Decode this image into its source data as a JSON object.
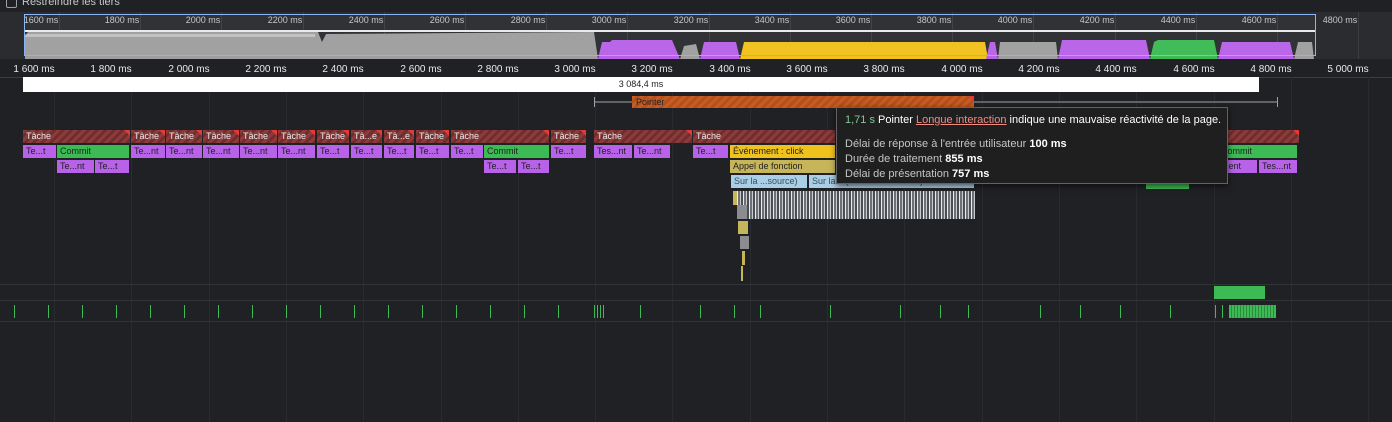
{
  "toolbar": {
    "checkbox_label": "Restreindre les tiers"
  },
  "overview": {
    "ticks": [
      "1600 ms",
      "1800 ms",
      "2000 ms",
      "2200 ms",
      "2400 ms",
      "2600 ms",
      "2800 ms",
      "3000 ms",
      "3200 ms",
      "3400 ms",
      "3600 ms",
      "3800 ms",
      "4000 ms",
      "4200 ms",
      "4400 ms",
      "4600 ms",
      "4800 ms"
    ]
  },
  "ruler": {
    "ticks": [
      "1 600 ms",
      "1 800 ms",
      "2 000 ms",
      "2 200 ms",
      "2 400 ms",
      "2 600 ms",
      "2 800 ms",
      "3 000 ms",
      "3 200 ms",
      "3 400 ms",
      "3 600 ms",
      "3 800 ms",
      "4 000 ms",
      "4 200 ms",
      "4 400 ms",
      "4 600 ms",
      "4 800 ms",
      "5 000 ms"
    ]
  },
  "range": {
    "label": "3 084,4 ms"
  },
  "interaction": {
    "label": "Pointer"
  },
  "tooltip": {
    "duration": "1,71 s",
    "type": "Pointer",
    "link": "Longue interaction",
    "message": "indique une mauvaise réactivité de la page.",
    "input_delay_label": "Délai de réponse à l'entrée utilisateur",
    "input_delay_value": "100 ms",
    "processing_label": "Durée de traitement",
    "processing_value": "855 ms",
    "presentation_label": "Délai de présentation",
    "presentation_value": "757 ms"
  },
  "flame": {
    "task": "Tâche",
    "task_short": "Tâ...e",
    "te_t": "Te...t",
    "te_nt": "Te...nt",
    "tes_nt": "Tes...nt",
    "tes_ent": "Tes...ent",
    "ent": "...ent",
    "commit": "Commit",
    "event_click": "Événement : click",
    "function_call": "Appel de fonction",
    "source_short": "Sur la ...source)",
    "source_long": "Sur la ...(sur ... la ... source)"
  },
  "colors": {
    "task": "#8d3a3a",
    "scripting": "#b762e8",
    "rendering": "#3cba54",
    "event": "#f0c21c",
    "function": "#c7b55a",
    "source": "#a9cfe6",
    "pointer": "#c75c23"
  }
}
